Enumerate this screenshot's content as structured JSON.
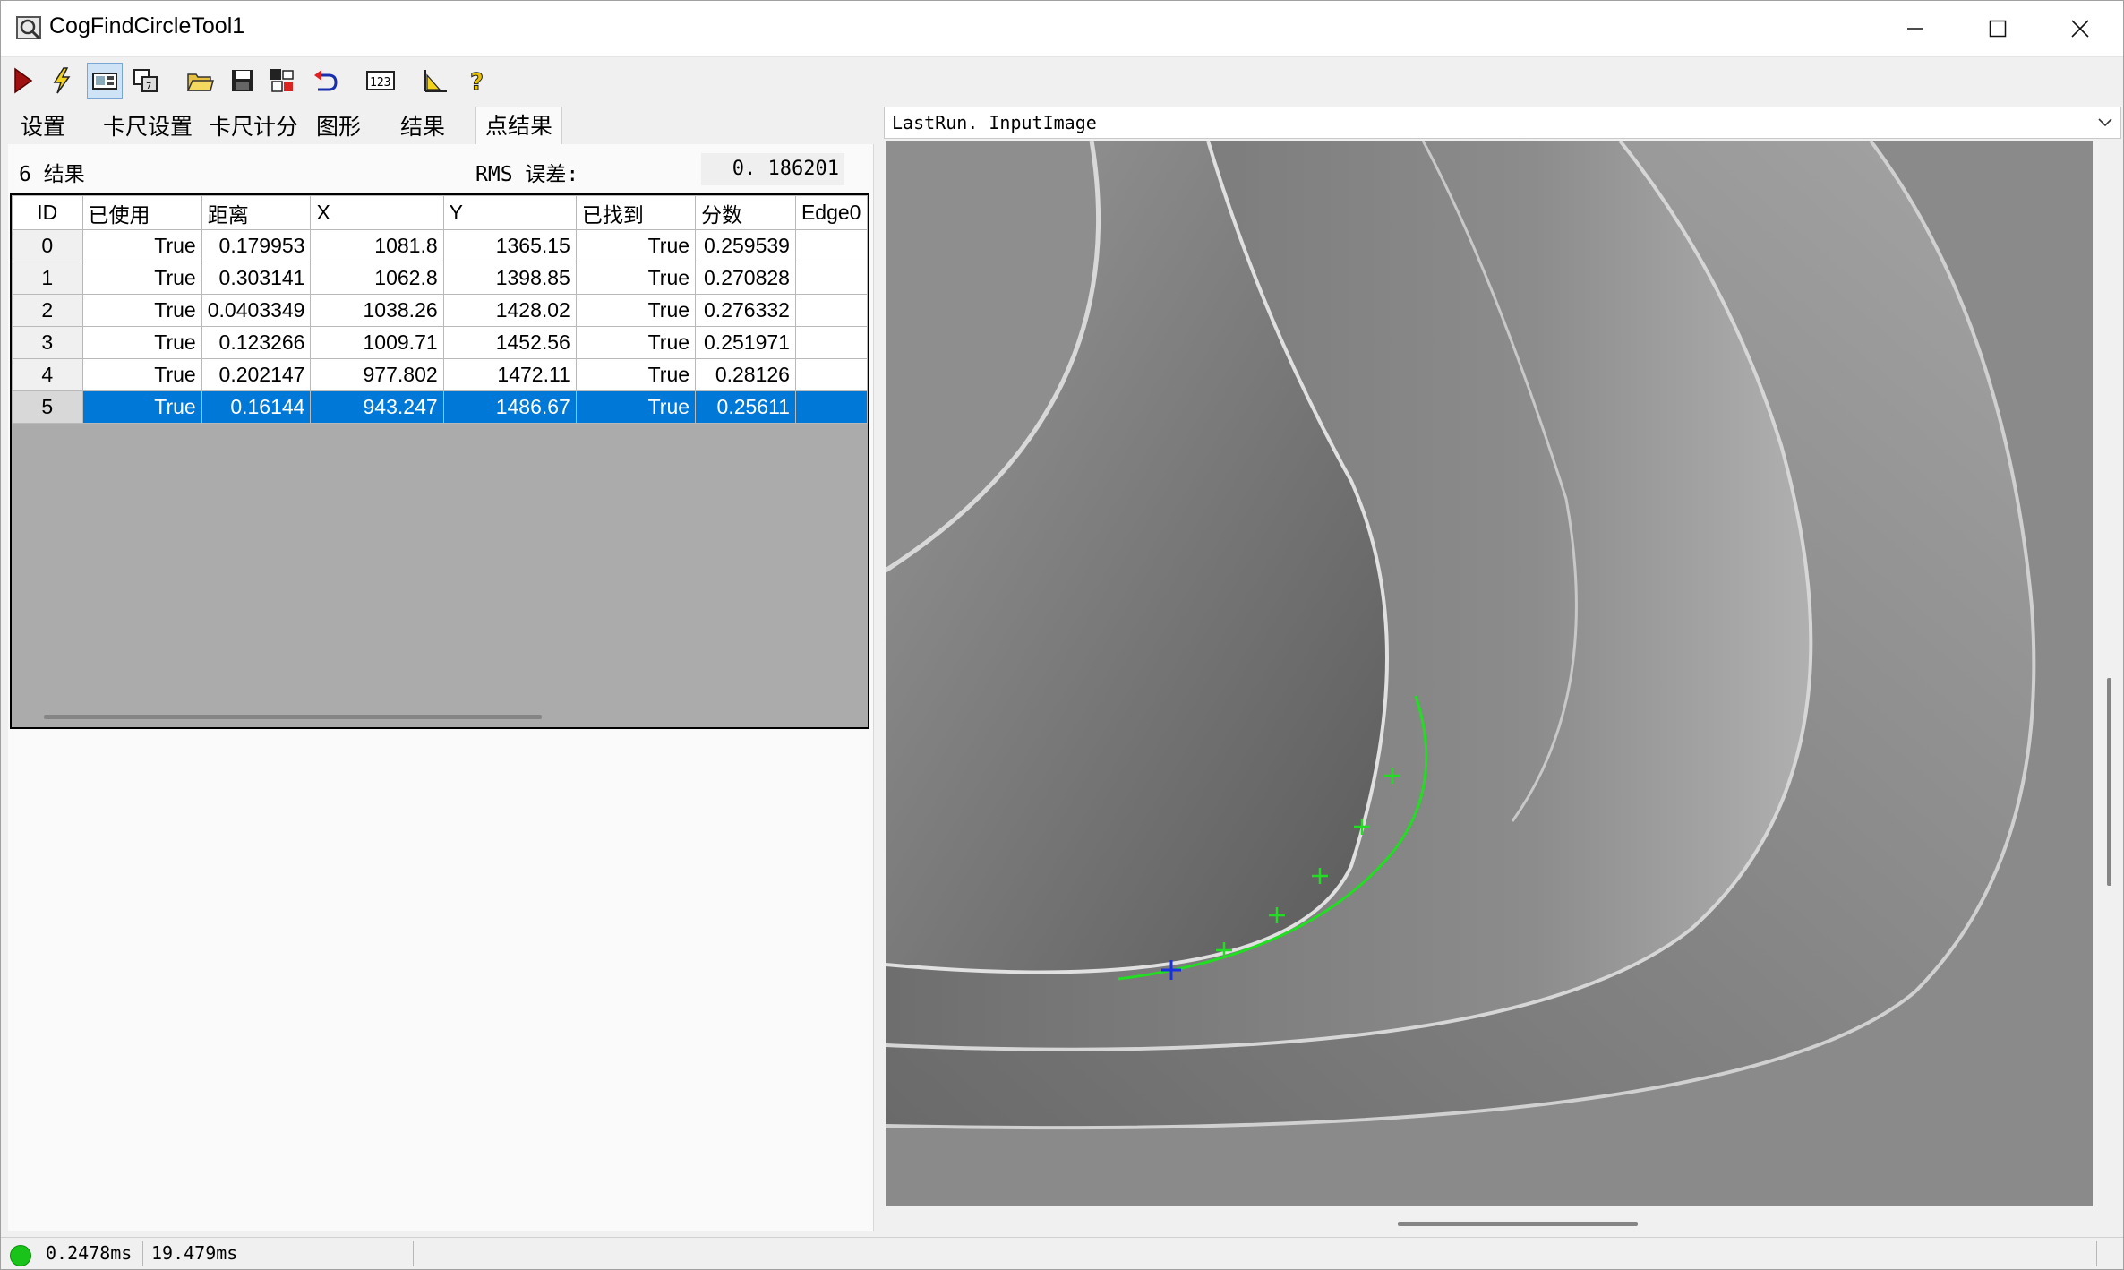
{
  "window": {
    "title": "CogFindCircleTool1"
  },
  "toolbar": [
    {
      "icon": "run-icon"
    },
    {
      "icon": "lightning-icon"
    },
    {
      "icon": "show-image-icon"
    },
    {
      "icon": "copy-icon"
    },
    {
      "icon": "open-folder-icon"
    },
    {
      "icon": "save-icon"
    },
    {
      "icon": "settings-grid-icon"
    },
    {
      "icon": "import-icon"
    },
    {
      "icon": "numeric-display-icon"
    },
    {
      "icon": "measure-icon"
    },
    {
      "icon": "help-icon"
    }
  ],
  "tabs": [
    "设置",
    "卡尺设置",
    "卡尺计分",
    "图形",
    "结果",
    "点结果"
  ],
  "active_tab": "点结果",
  "results": {
    "count_label": "6 结果",
    "rms_label": "RMS 误差:",
    "rms_value": "0. 186201",
    "columns": [
      "ID",
      "已使用",
      "距离",
      "X",
      "Y",
      "已找到",
      "分数",
      "Edge0"
    ],
    "rows": [
      [
        "0",
        "True",
        "0.179953",
        "1081.8",
        "1365.15",
        "True",
        "0.259539",
        ""
      ],
      [
        "1",
        "True",
        "0.303141",
        "1062.8",
        "1398.85",
        "True",
        "0.270828",
        ""
      ],
      [
        "2",
        "True",
        "0.0403349",
        "1038.26",
        "1428.02",
        "True",
        "0.276332",
        ""
      ],
      [
        "3",
        "True",
        "0.123266",
        "1009.71",
        "1452.56",
        "True",
        "0.251971",
        ""
      ],
      [
        "4",
        "True",
        "0.202147",
        "977.802",
        "1472.11",
        "True",
        "0.28126",
        ""
      ],
      [
        "5",
        "True",
        "0.16144",
        "943.247",
        "1486.67",
        "True",
        "0.25611",
        ""
      ]
    ],
    "selected_row": 5
  },
  "display": {
    "selected_image": "LastRun. InputImage"
  },
  "status": {
    "time1": "0.2478ms",
    "time2": "19.479ms",
    "indicator_color": "#19c31a"
  }
}
